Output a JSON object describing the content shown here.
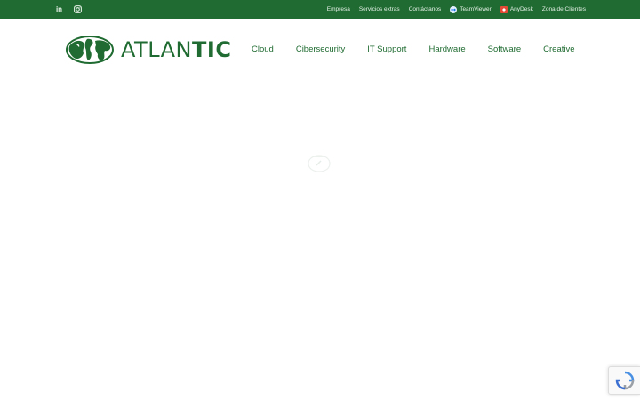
{
  "topbar": {
    "bg_color": "#1f6b31",
    "social": [
      {
        "icon": "linkedin-icon",
        "label": "in"
      },
      {
        "icon": "instagram-icon"
      }
    ],
    "links": [
      {
        "label": "Empresa"
      },
      {
        "label": "Servicios extras"
      },
      {
        "label": "Contáctanos"
      },
      {
        "label": "TeamViewer",
        "icon": "teamviewer-icon"
      },
      {
        "label": "AnyDesk",
        "icon": "anydesk-icon"
      },
      {
        "label": "Zona de Clientes"
      }
    ]
  },
  "header": {
    "logo": {
      "text_light": "ATLAN",
      "text_bold": "TIC",
      "icon": "globe-icon"
    },
    "nav": [
      {
        "label": "Cloud"
      },
      {
        "label": "Cibersecurity"
      },
      {
        "label": "IT Support"
      },
      {
        "label": "Hardware"
      },
      {
        "label": "Software"
      },
      {
        "label": "Creative"
      }
    ]
  },
  "main": {
    "loader_icon": "loading-icon"
  },
  "recaptcha": {
    "icon": "recaptcha-icon"
  },
  "colors": {
    "brand": "#1f6b31",
    "anydesk": "#e44a36"
  }
}
